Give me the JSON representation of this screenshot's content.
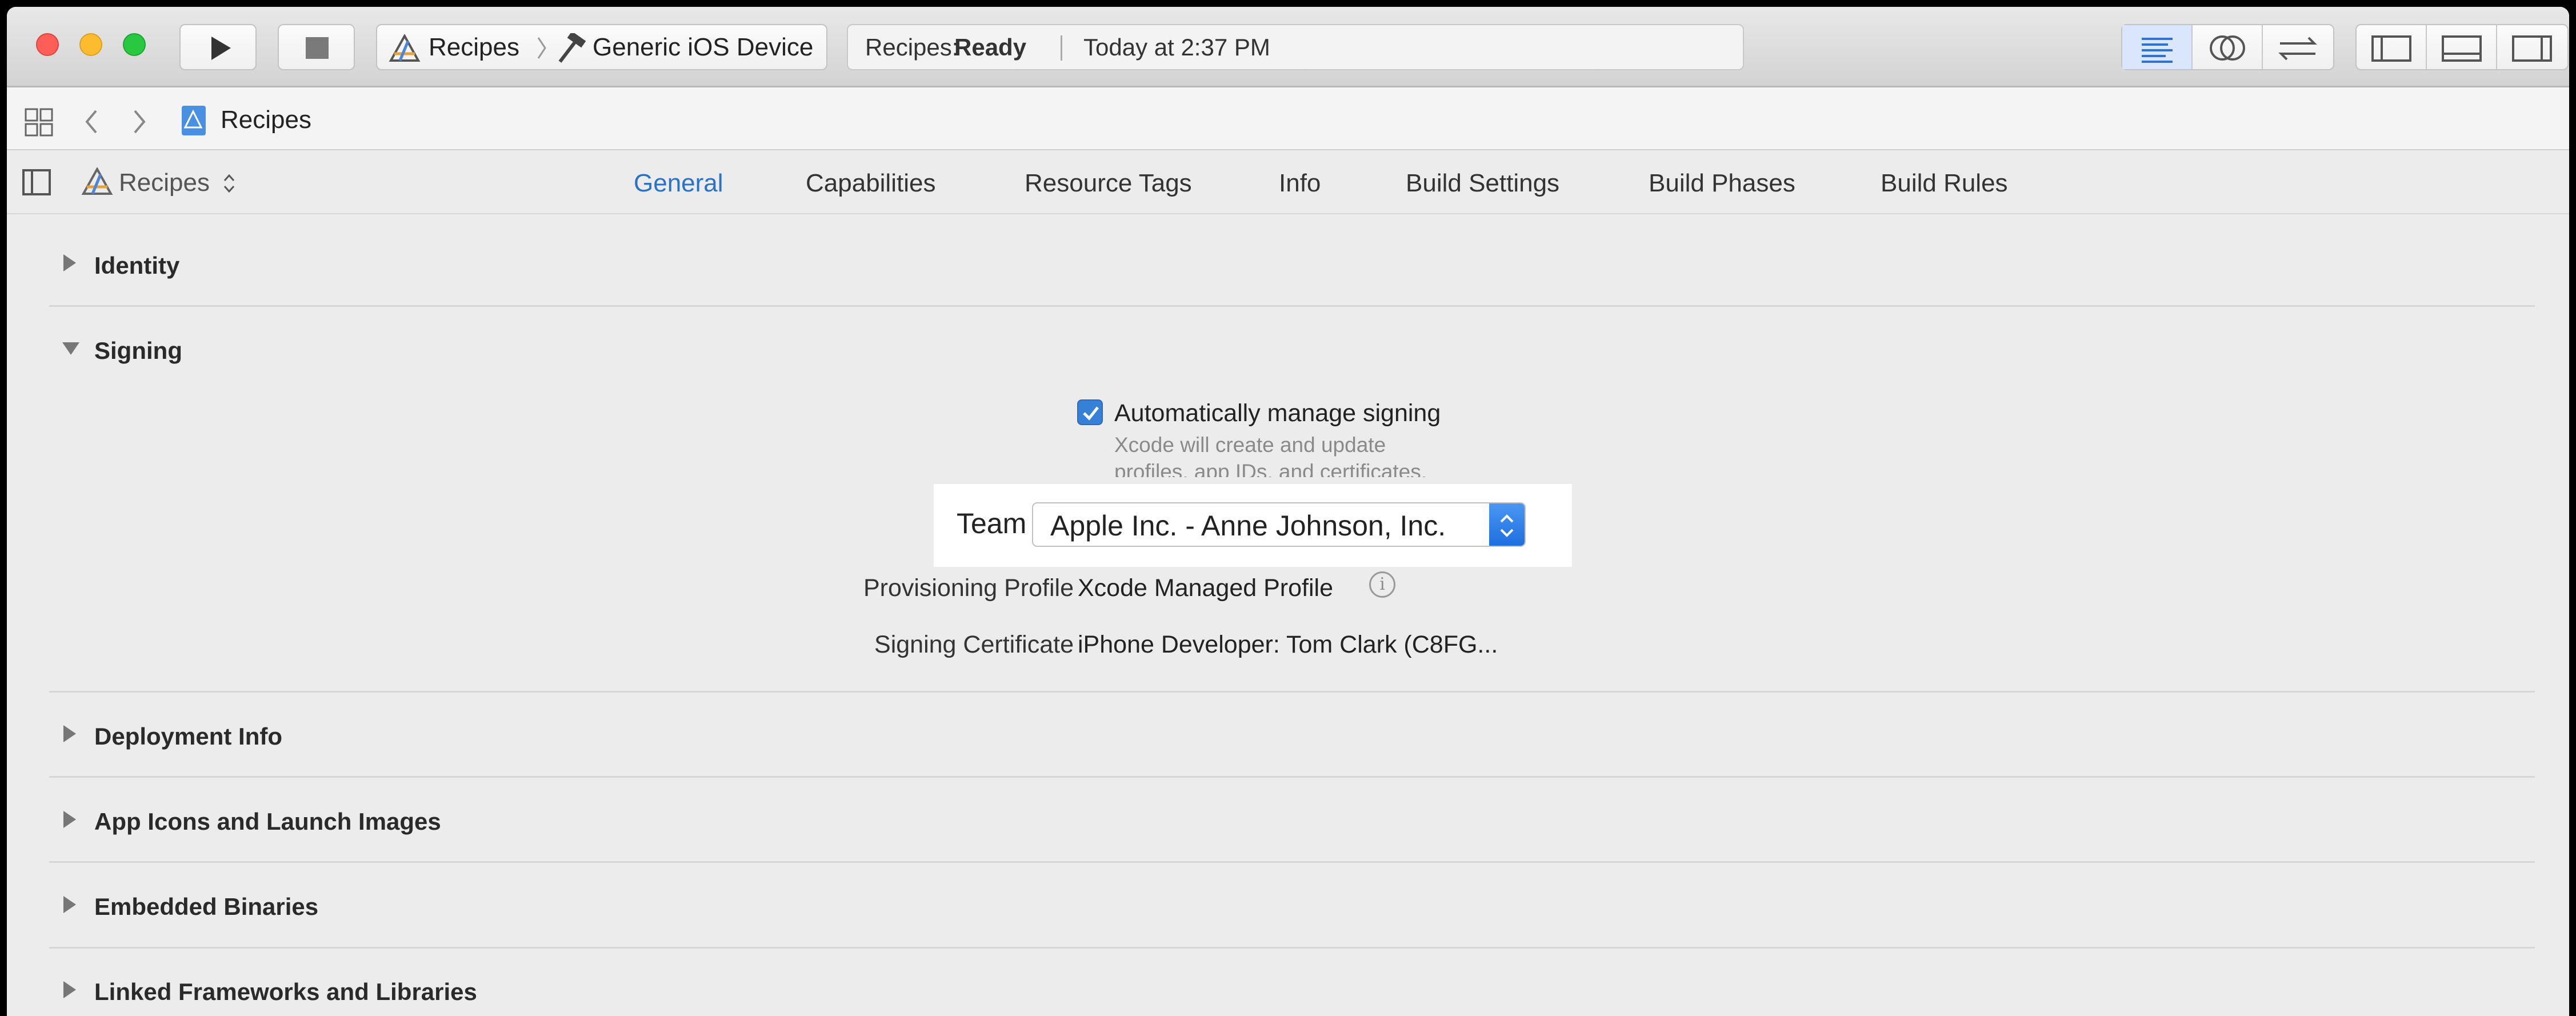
{
  "toolbar": {
    "scheme": {
      "target": "Recipes",
      "device": "Generic iOS Device"
    },
    "activity": {
      "prefix": "Recipes: ",
      "status": "Ready",
      "timestamp": "Today at 2:37 PM"
    }
  },
  "jumpbar": {
    "file": "Recipes"
  },
  "editor": {
    "target_selector": "Recipes",
    "tabs": [
      {
        "label": "General",
        "active": true
      },
      {
        "label": "Capabilities",
        "active": false
      },
      {
        "label": "Resource Tags",
        "active": false
      },
      {
        "label": "Info",
        "active": false
      },
      {
        "label": "Build Settings",
        "active": false
      },
      {
        "label": "Build Phases",
        "active": false
      },
      {
        "label": "Build Rules",
        "active": false
      }
    ]
  },
  "sections": {
    "identity": "Identity",
    "signing": "Signing",
    "deployment": "Deployment Info",
    "app_icons": "App Icons and Launch Images",
    "embedded": "Embedded Binaries",
    "linked": "Linked Frameworks and Libraries"
  },
  "signing": {
    "auto_manage_label": "Automatically manage signing",
    "auto_manage_checked": true,
    "help_line1": "Xcode will create and update",
    "help_line2": "profiles, app IDs, and certificates.",
    "team_label": "Team",
    "team_value": "Apple Inc. - Anne Johnson, Inc.",
    "provisioning_label": "Provisioning Profile",
    "provisioning_value": "Xcode Managed Profile",
    "certificate_label": "Signing Certificate",
    "certificate_value": "iPhone Developer: Tom Clark (C8FG..."
  },
  "colors": {
    "accent": "#2a72c8",
    "checkbox": "#3581d8",
    "close": "#fd5e57",
    "minimize": "#fdbc2e",
    "zoom": "#28c840"
  }
}
